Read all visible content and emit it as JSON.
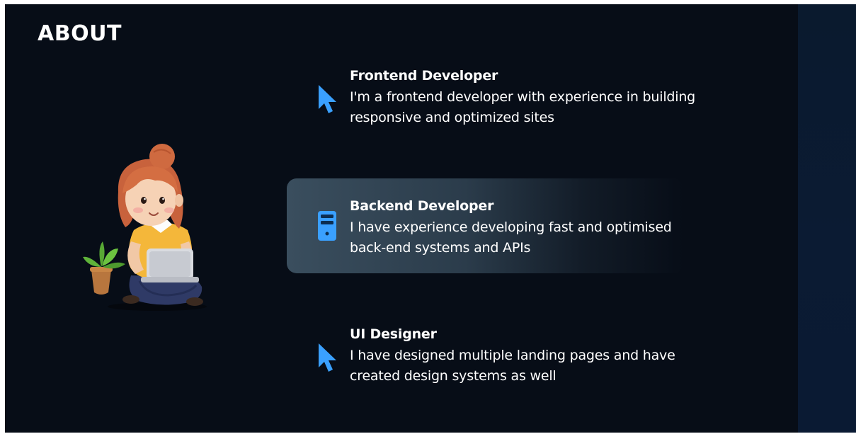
{
  "section": {
    "title": "ABOUT"
  },
  "illustration": {
    "subject": "girl-with-laptop-and-plant"
  },
  "cards": [
    {
      "title": "Frontend Developer",
      "description_lines": [
        "I'm a frontend developer with experience in building",
        "responsive and optimized sites"
      ],
      "icon": "cursor-icon",
      "active": false
    },
    {
      "title": "Backend Developer",
      "description_lines": [
        "I have experience developing fast and optimised",
        "back-end systems and APIs"
      ],
      "icon": "server-icon",
      "active": true
    },
    {
      "title": "UI Designer",
      "description_lines": [
        "I have designed multiple landing pages and have",
        "created design systems as well"
      ],
      "icon": "cursor-icon",
      "active": false
    }
  ],
  "colors": {
    "background": "#070d17",
    "accent": "#3aa0ff",
    "text": "#ffffff",
    "active_card": "#3a4e5e"
  }
}
